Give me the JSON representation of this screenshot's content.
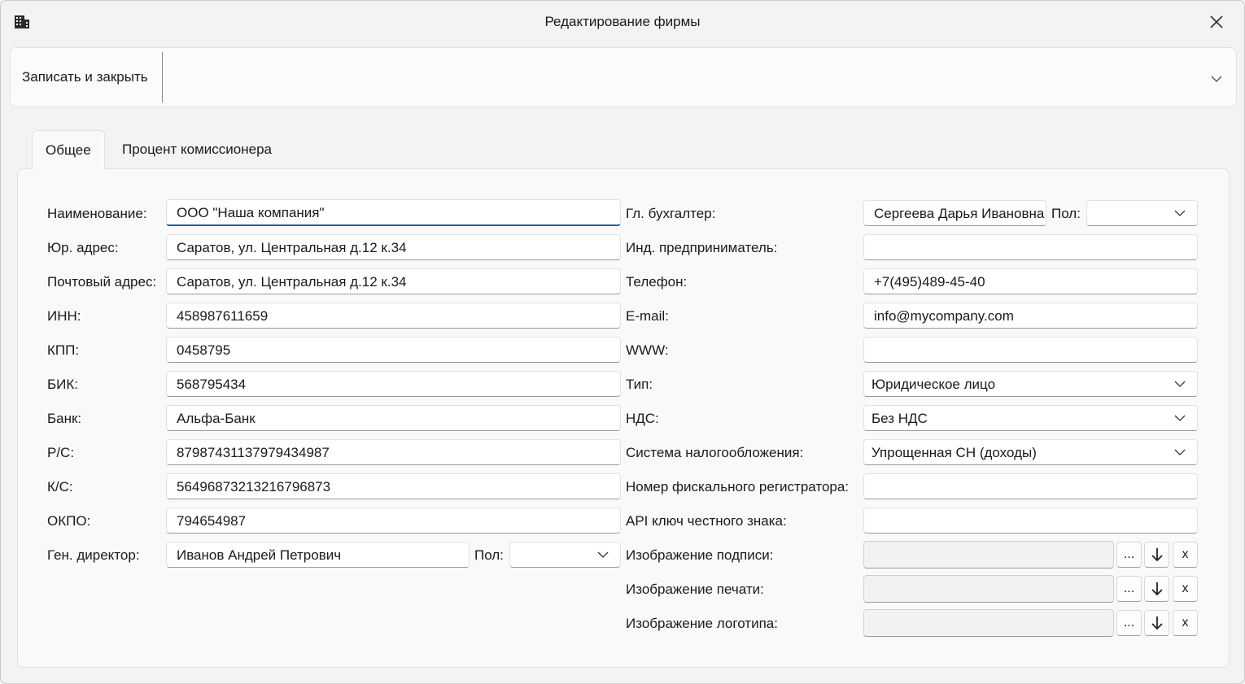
{
  "window": {
    "title": "Редактирование фирмы"
  },
  "toolbar": {
    "save_close": "Записать и закрыть"
  },
  "tabs": [
    {
      "label": "Общее"
    },
    {
      "label": "Процент комиссионера"
    }
  ],
  "left": {
    "name": {
      "label": "Наименование:",
      "value": "ООО \"Наша компания\""
    },
    "legal_address": {
      "label": "Юр. адрес:",
      "value": "Саратов, ул. Центральная д.12 к.34"
    },
    "postal_address": {
      "label": "Почтовый адрес:",
      "value": "Саратов, ул. Центральная д.12 к.34"
    },
    "inn": {
      "label": "ИНН:",
      "value": "458987611659"
    },
    "kpp": {
      "label": "КПП:",
      "value": "0458795"
    },
    "bik": {
      "label": "БИК:",
      "value": "568795434"
    },
    "bank": {
      "label": "Банк:",
      "value": "Альфа-Банк"
    },
    "rs": {
      "label": "Р/С:",
      "value": "87987431137979434987"
    },
    "ks": {
      "label": "К/С:",
      "value": "56496873213216796873"
    },
    "okpo": {
      "label": "ОКПО:",
      "value": "794654987"
    },
    "director": {
      "label": "Ген. директор:",
      "value": "Иванов Андрей Петрович",
      "gender_label": "Пол:",
      "gender_value": ""
    }
  },
  "right": {
    "accountant": {
      "label": "Гл. бухгалтер:",
      "value": "Сергеева Дарья Ивановна",
      "gender_label": "Пол:",
      "gender_value": ""
    },
    "entrepreneur": {
      "label": "Инд. предприниматель:",
      "value": ""
    },
    "phone": {
      "label": "Телефон:",
      "value": "+7(495)489-45-40"
    },
    "email": {
      "label": "E-mail:",
      "value": "info@mycompany.com"
    },
    "www": {
      "label": "WWW:",
      "value": ""
    },
    "type": {
      "label": "Тип:",
      "value": "Юридическое лицо"
    },
    "vat": {
      "label": "НДС:",
      "value": "Без НДС"
    },
    "tax_system": {
      "label": "Система налогообложения:",
      "value": "Упрощенная СН (доходы)"
    },
    "fiscal": {
      "label": "Номер фискального регистратора:",
      "value": ""
    },
    "api_key": {
      "label": "API ключ честного знака:",
      "value": ""
    },
    "signature": {
      "label": "Изображение подписи:"
    },
    "stamp": {
      "label": "Изображение печати:"
    },
    "logo": {
      "label": "Изображение логотипа:"
    },
    "browse_label": "...",
    "clear_label": "x"
  },
  "icons": {
    "app": "building-icon",
    "close": "close-icon",
    "expand": "chevron-down-icon",
    "download": "arrow-down-icon"
  }
}
